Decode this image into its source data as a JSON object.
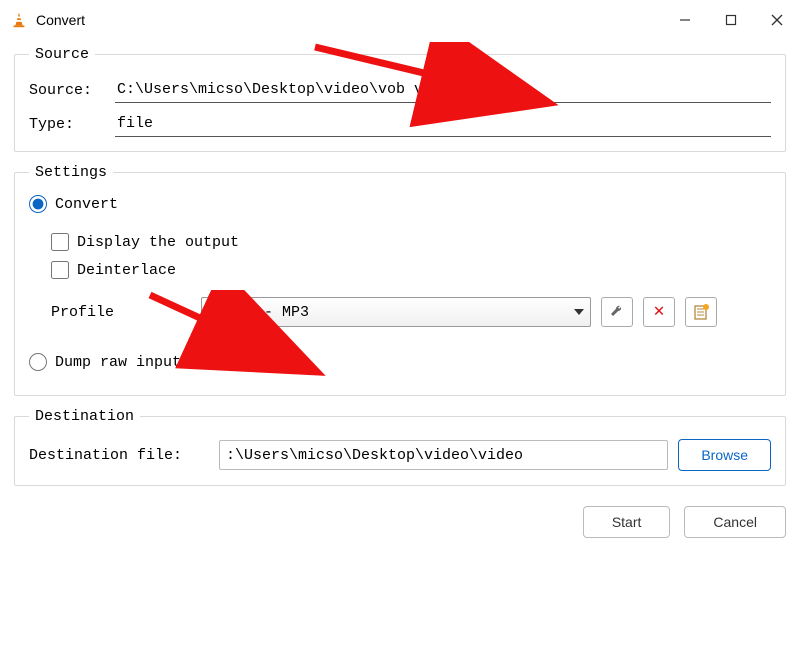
{
  "window": {
    "title": "Convert"
  },
  "source": {
    "legend": "Source",
    "source_label": "Source:",
    "source_value": "C:\\Users\\micso\\Desktop\\video\\vob video.vob",
    "type_label": "Type:",
    "type_value": "file"
  },
  "settings": {
    "legend": "Settings",
    "convert_label": "Convert",
    "display_output_label": "Display the output",
    "deinterlace_label": "Deinterlace",
    "profile_label": "Profile",
    "profile_selected": "Audio - MP3",
    "dump_label": "Dump raw input"
  },
  "destination": {
    "legend": "Destination",
    "file_label": "Destination file:",
    "file_value": ":\\Users\\micso\\Desktop\\video\\video",
    "browse_label": "Browse"
  },
  "buttons": {
    "start": "Start",
    "cancel": "Cancel"
  }
}
